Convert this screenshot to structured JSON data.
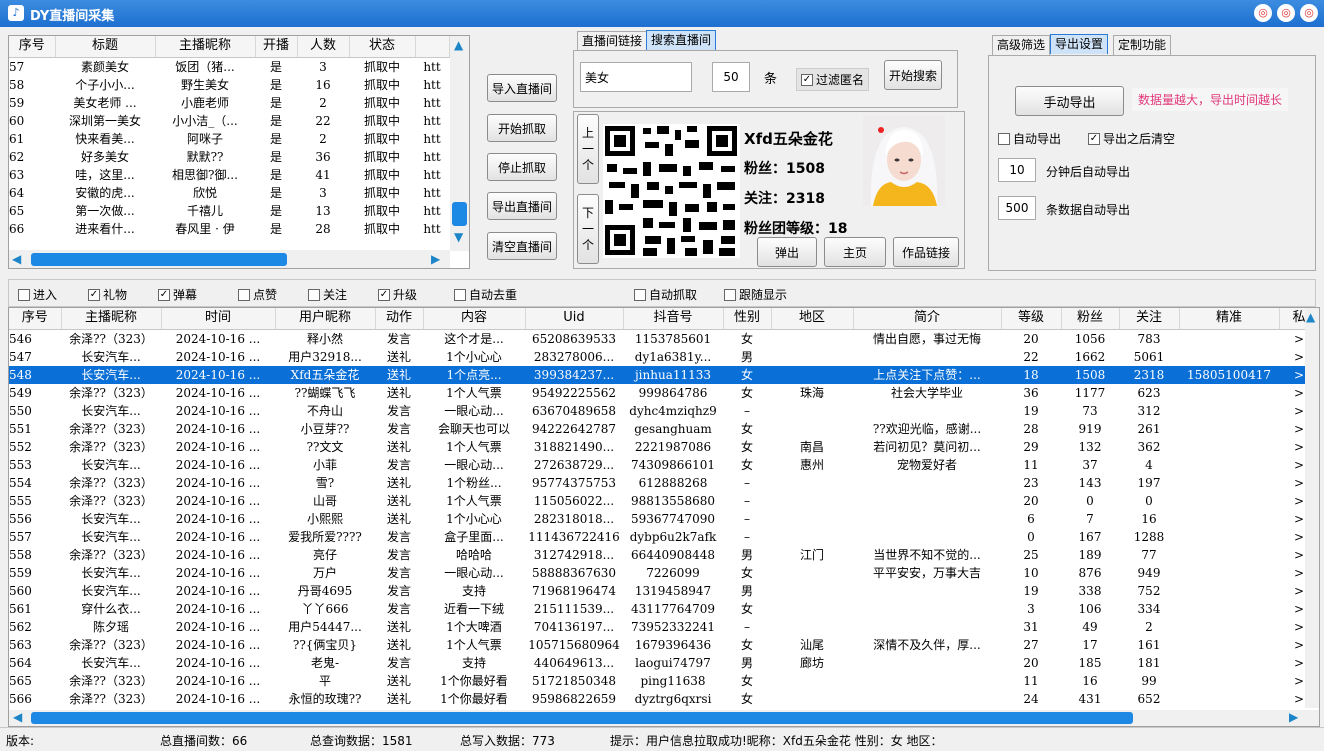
{
  "window": {
    "title": "DY直播间采集"
  },
  "live_table": {
    "columns": [
      "序号",
      "标题",
      "主播昵称",
      "开播",
      "人数",
      "状态"
    ],
    "rows": [
      [
        "57",
        "素颜美女",
        "饭团（猪...",
        "是",
        "3",
        "抓取中",
        "htt"
      ],
      [
        "58",
        "个子小小...",
        "野生美女",
        "是",
        "16",
        "抓取中",
        "htt"
      ],
      [
        "59",
        "美女老师 ...",
        "小鹿老师",
        "是",
        "2",
        "抓取中",
        "htt"
      ],
      [
        "60",
        "深圳第一美女",
        "小小洁_（...",
        "是",
        "22",
        "抓取中",
        "htt"
      ],
      [
        "61",
        "快来看美...",
        "阿咪子",
        "是",
        "2",
        "抓取中",
        "htt"
      ],
      [
        "62",
        "好多美女",
        "默默??",
        "是",
        "36",
        "抓取中",
        "htt"
      ],
      [
        "63",
        "哇，这里...",
        "相思御?御...",
        "是",
        "41",
        "抓取中",
        "htt"
      ],
      [
        "64",
        "安徽的虎...",
        "欣悦",
        "是",
        "3",
        "抓取中",
        "htt"
      ],
      [
        "65",
        "第一次做...",
        "千禧儿",
        "是",
        "13",
        "抓取中",
        "htt"
      ],
      [
        "66",
        "进来看什...",
        "春风里 · 伊",
        "是",
        "28",
        "抓取中",
        "htt"
      ]
    ]
  },
  "mid_buttons": {
    "import": "导入直播间",
    "start": "开始抓取",
    "stop": "停止抓取",
    "export": "导出直播间",
    "clear": "清空直播间"
  },
  "search": {
    "tabs": [
      "直播间链接",
      "搜索直播间"
    ],
    "keyword": "美女",
    "count": "50",
    "count_unit": "条",
    "filter_anon": "过滤匿名",
    "start_button": "开始搜索"
  },
  "profile": {
    "prev": "上一个",
    "next": "下一个",
    "name": "Xfd五朵金花",
    "fans": "粉丝：1508",
    "follow": "关注：2318",
    "fan_group": "粉丝团等级：18",
    "btn_popup": "弹出",
    "btn_home": "主页",
    "btn_works": "作品链接"
  },
  "export": {
    "tabs": [
      "高级筛选",
      "导出设置",
      "定制功能"
    ],
    "manual_export": "手动导出",
    "warning": "数据量越大，导出时间越长",
    "auto_export": "自动导出",
    "clear_after": "导出之后清空",
    "minutes_value": "10",
    "minutes_label": "分钟后自动导出",
    "rows_value": "500",
    "rows_label": "条数据自动导出"
  },
  "filters": [
    {
      "label": "进入",
      "checked": false
    },
    {
      "label": "礼物",
      "checked": true
    },
    {
      "label": "弹幕",
      "checked": true
    },
    {
      "label": "点赞",
      "checked": false
    },
    {
      "label": "关注",
      "checked": false
    },
    {
      "label": "升级",
      "checked": true
    },
    {
      "label": "自动去重",
      "checked": false
    },
    {
      "label": "自动抓取",
      "checked": false
    },
    {
      "label": "跟随显示",
      "checked": false
    }
  ],
  "event_table": {
    "columns": [
      "序号",
      "主播昵称",
      "时间",
      "用户昵称",
      "动作",
      "内容",
      "Uid",
      "抖音号",
      "性别",
      "地区",
      "简介",
      "等级",
      "粉丝",
      "关注",
      "精准",
      "私"
    ],
    "selected_index": 2,
    "rows": [
      [
        "546",
        "余泽??（323）",
        "2024-10-16 ...",
        "释小然",
        "发言",
        "这个才是...",
        "65208639533",
        "1153785601",
        "女",
        "",
        "情出自愿，事过无悔",
        "20",
        "1056",
        "783",
        "",
        ">"
      ],
      [
        "547",
        "长安汽车...",
        "2024-10-16 ...",
        "用户32918...",
        "送礼",
        "1个小心心",
        "283278006...",
        "dy1a6381y...",
        "男",
        "",
        "",
        "22",
        "1662",
        "5061",
        "",
        ">"
      ],
      [
        "548",
        "长安汽车...",
        "2024-10-16 ...",
        "Xfd五朵金花",
        "送礼",
        "1个点亮...",
        "399384237...",
        "jinhua11133",
        "女",
        "",
        "上点关注下点赞：...",
        "18",
        "1508",
        "2318",
        "15805100417",
        ">"
      ],
      [
        "549",
        "余泽??（323）",
        "2024-10-16 ...",
        "??蝴蝶飞飞",
        "送礼",
        "1个人气票",
        "95492225562",
        "999864786",
        "女",
        "珠海",
        "社会大学毕业",
        "36",
        "1177",
        "623",
        "",
        ">"
      ],
      [
        "550",
        "长安汽车...",
        "2024-10-16 ...",
        "不舟山",
        "发言",
        "一眼心动...",
        "63670489658",
        "dyhc4mziqhz9",
        "–",
        "",
        "",
        "19",
        "73",
        "312",
        "",
        ">"
      ],
      [
        "551",
        "余泽??（323）",
        "2024-10-16 ...",
        "小豆芽??",
        "发言",
        "会聊天也可以",
        "94222642787",
        "gesanghuam",
        "女",
        "",
        "??欢迎光临，感谢...",
        "28",
        "919",
        "261",
        "",
        ">"
      ],
      [
        "552",
        "余泽??（323）",
        "2024-10-16 ...",
        "??文文",
        "送礼",
        "1个人气票",
        "318821490...",
        "2221987086",
        "女",
        "南昌",
        "若问初见？莫问初...",
        "29",
        "132",
        "362",
        "",
        ">"
      ],
      [
        "553",
        "长安汽车...",
        "2024-10-16 ...",
        "小菲",
        "发言",
        "一眼心动...",
        "272638729...",
        "74309866101",
        "女",
        "惠州",
        "宠物爱好者",
        "11",
        "37",
        "4",
        "",
        ">"
      ],
      [
        "554",
        "余泽??（323）",
        "2024-10-16 ...",
        "雪?",
        "送礼",
        "1个粉丝...",
        "95774375753",
        "612888268",
        "–",
        "",
        "",
        "23",
        "143",
        "197",
        "",
        ">"
      ],
      [
        "555",
        "余泽??（323）",
        "2024-10-16 ...",
        "山哥",
        "送礼",
        "1个人气票",
        "115056022...",
        "98813558680",
        "–",
        "",
        "",
        "20",
        "0",
        "0",
        "",
        ">"
      ],
      [
        "556",
        "长安汽车...",
        "2024-10-16 ...",
        "小熙熙",
        "送礼",
        "1个小心心",
        "282318018...",
        "59367747090",
        "–",
        "",
        "",
        "6",
        "7",
        "16",
        "",
        ">"
      ],
      [
        "557",
        "长安汽车...",
        "2024-10-16 ...",
        "爱我所爱????",
        "发言",
        "盒子里面...",
        "111436722416",
        "dybp6u2k7afk",
        "–",
        "",
        "",
        "0",
        "167",
        "1288",
        "",
        ">"
      ],
      [
        "558",
        "余泽??（323）",
        "2024-10-16 ...",
        "亮仔",
        "发言",
        "哈哈哈",
        "312742918...",
        "66440908448",
        "男",
        "江门",
        "当世界不知不觉的...",
        "25",
        "189",
        "77",
        "",
        ">"
      ],
      [
        "559",
        "长安汽车...",
        "2024-10-16 ...",
        "万户",
        "发言",
        "一眼心动...",
        "58888367630",
        "7226099",
        "女",
        "",
        "平平安安，万事大吉",
        "10",
        "876",
        "949",
        "",
        ">"
      ],
      [
        "560",
        "长安汽车...",
        "2024-10-16 ...",
        "丹哥4695",
        "发言",
        "支持",
        "71968196474",
        "1319458947",
        "男",
        "",
        "",
        "19",
        "338",
        "752",
        "",
        ">"
      ],
      [
        "561",
        "穿什么衣...",
        "2024-10-16 ...",
        "丫丫666",
        "发言",
        "近看一下绒",
        "215111539...",
        "43117764709",
        "女",
        "",
        "",
        "3",
        "106",
        "334",
        "",
        ">"
      ],
      [
        "562",
        "陈夕瑶",
        "2024-10-16 ...",
        "用户54447...",
        "送礼",
        "1个大啤酒",
        "704136197...",
        "73952332241",
        "–",
        "",
        "",
        "31",
        "49",
        "2",
        "",
        ">"
      ],
      [
        "563",
        "余泽??（323）",
        "2024-10-16 ...",
        "??{俩宝贝}",
        "送礼",
        "1个人气票",
        "105715680964",
        "1679396436",
        "女",
        "汕尾",
        "深情不及久伴，厚...",
        "27",
        "17",
        "161",
        "",
        ">"
      ],
      [
        "564",
        "长安汽车...",
        "2024-10-16 ...",
        "老鬼-",
        "发言",
        "支持",
        "440649613...",
        "laogui74797",
        "男",
        "廊坊",
        "",
        "20",
        "185",
        "181",
        "",
        ">"
      ],
      [
        "565",
        "余泽??（323）",
        "2024-10-16 ...",
        "平",
        "送礼",
        "1个你最好看",
        "51721850348",
        "ping11638",
        "女",
        "",
        "",
        "11",
        "16",
        "99",
        "",
        ">"
      ],
      [
        "566",
        "余泽??（323）",
        "2024-10-16 ...",
        "永恒的玫瑰??",
        "送礼",
        "1个你最好看",
        "95986822659",
        "dyztrg6qxrsi",
        "女",
        "",
        "",
        "24",
        "431",
        "652",
        "",
        ">"
      ]
    ]
  },
  "status": {
    "version": "版本:",
    "total_rooms": "总直播间数：66",
    "total_query": "总查询数据：1581",
    "total_written": "总写入数据：773",
    "hint": "提示：用户信息拉取成功!昵称：Xfd五朵金花 性别：女 地区："
  }
}
